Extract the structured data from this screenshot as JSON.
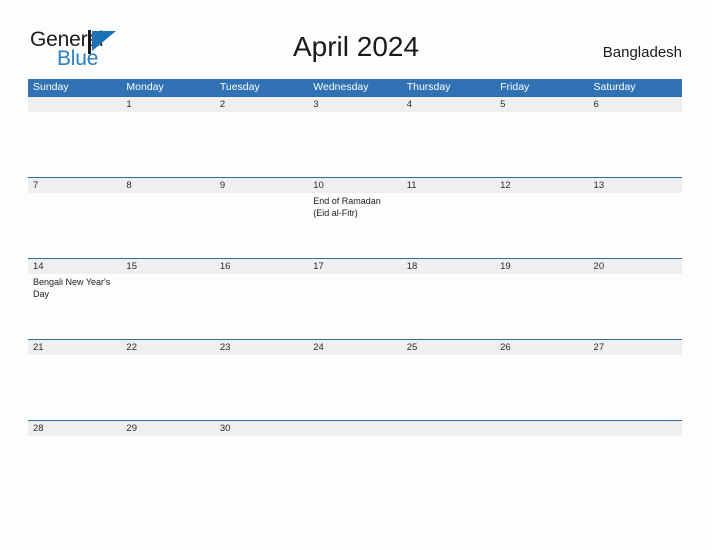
{
  "branding": {
    "name_primary": "General",
    "name_secondary": "Blue",
    "flag_icon": "blue-flag-icon",
    "primary_color": "#1c1c1c",
    "secondary_color": "#2b7fc4"
  },
  "header": {
    "title": "April 2024",
    "country": "Bangladesh"
  },
  "theme": {
    "header_blue": "#3072b4",
    "rule_blue": "#2e6da4",
    "number_band_gray": "#efefef",
    "page_background": "#fdfdfd"
  },
  "calendar": {
    "day_headers": [
      "Sunday",
      "Monday",
      "Tuesday",
      "Wednesday",
      "Thursday",
      "Friday",
      "Saturday"
    ],
    "weeks": [
      {
        "days": [
          {
            "number": "",
            "events": []
          },
          {
            "number": "1",
            "events": []
          },
          {
            "number": "2",
            "events": []
          },
          {
            "number": "3",
            "events": []
          },
          {
            "number": "4",
            "events": []
          },
          {
            "number": "5",
            "events": []
          },
          {
            "number": "6",
            "events": []
          }
        ]
      },
      {
        "days": [
          {
            "number": "7",
            "events": []
          },
          {
            "number": "8",
            "events": []
          },
          {
            "number": "9",
            "events": []
          },
          {
            "number": "10",
            "events": [
              "End of Ramadan (Eid al-Fitr)"
            ]
          },
          {
            "number": "11",
            "events": []
          },
          {
            "number": "12",
            "events": []
          },
          {
            "number": "13",
            "events": []
          }
        ]
      },
      {
        "days": [
          {
            "number": "14",
            "events": [
              "Bengali New Year's Day"
            ]
          },
          {
            "number": "15",
            "events": []
          },
          {
            "number": "16",
            "events": []
          },
          {
            "number": "17",
            "events": []
          },
          {
            "number": "18",
            "events": []
          },
          {
            "number": "19",
            "events": []
          },
          {
            "number": "20",
            "events": []
          }
        ]
      },
      {
        "days": [
          {
            "number": "21",
            "events": []
          },
          {
            "number": "22",
            "events": []
          },
          {
            "number": "23",
            "events": []
          },
          {
            "number": "24",
            "events": []
          },
          {
            "number": "25",
            "events": []
          },
          {
            "number": "26",
            "events": []
          },
          {
            "number": "27",
            "events": []
          }
        ]
      },
      {
        "days": [
          {
            "number": "28",
            "events": []
          },
          {
            "number": "29",
            "events": []
          },
          {
            "number": "30",
            "events": []
          },
          {
            "number": "",
            "events": []
          },
          {
            "number": "",
            "events": []
          },
          {
            "number": "",
            "events": []
          },
          {
            "number": "",
            "events": []
          }
        ]
      }
    ]
  }
}
